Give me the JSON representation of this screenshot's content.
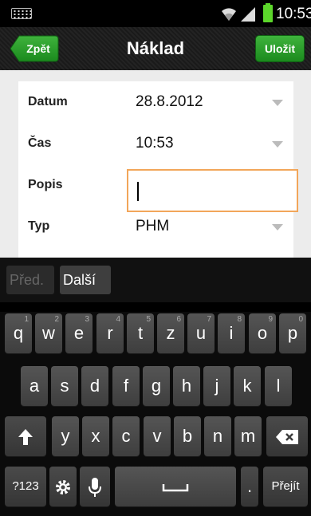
{
  "status": {
    "time": "10:53"
  },
  "header": {
    "back_label": "Zpět",
    "title": "Náklad",
    "save_label": "Uložit"
  },
  "form": {
    "rows": [
      {
        "label": "Datum",
        "value": "28.8.2012"
      },
      {
        "label": "Čas",
        "value": "10:53"
      },
      {
        "label": "Popis",
        "value": ""
      },
      {
        "label": "Typ",
        "value": "PHM"
      }
    ]
  },
  "keyboard": {
    "prev_label": "Před.",
    "next_label": "Další",
    "row1": [
      {
        "key": "q",
        "hint": "1"
      },
      {
        "key": "w",
        "hint": "2"
      },
      {
        "key": "e",
        "hint": "3"
      },
      {
        "key": "r",
        "hint": "4"
      },
      {
        "key": "t",
        "hint": "5"
      },
      {
        "key": "z",
        "hint": "6"
      },
      {
        "key": "u",
        "hint": "7"
      },
      {
        "key": "i",
        "hint": "8"
      },
      {
        "key": "o",
        "hint": "9"
      },
      {
        "key": "p",
        "hint": "0"
      }
    ],
    "row2": [
      "a",
      "s",
      "d",
      "f",
      "g",
      "h",
      "j",
      "k",
      "l"
    ],
    "row3": [
      "y",
      "x",
      "c",
      "v",
      "b",
      "n",
      "m"
    ],
    "symbols_label": "?123",
    "period_label": ".",
    "go_label": "Přejít"
  }
}
